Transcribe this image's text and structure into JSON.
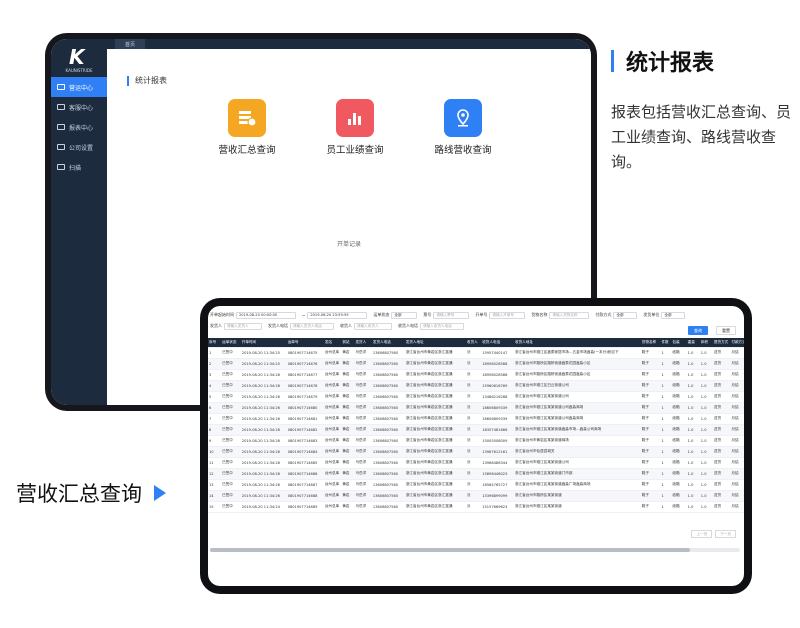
{
  "colors": {
    "accent": "#2f7ff5",
    "sidebar": "#1d2b3e",
    "card1": "#f5a623",
    "card2": "#f0595f",
    "card3": "#2f7ff5"
  },
  "app": {
    "logo_letter": "K",
    "logo_text": "KAUNISTRIDE",
    "home_tab": "首页",
    "nav": [
      {
        "label": "营运中心",
        "icon": "send-icon",
        "active": true
      },
      {
        "label": "客服中心",
        "icon": "headset-icon"
      },
      {
        "label": "报表中心",
        "icon": "chart-icon"
      },
      {
        "label": "公司设置",
        "icon": "building-icon"
      },
      {
        "label": "扫描",
        "icon": "scan-icon"
      }
    ],
    "section_title": "统计报表",
    "reports": [
      {
        "label": "营收汇总查询",
        "icon": "coin-stack-icon"
      },
      {
        "label": "员工业绩查询",
        "icon": "bar-chart-icon"
      },
      {
        "label": "路线营收查询",
        "icon": "location-pin-icon"
      }
    ],
    "empty_note": "开单记录"
  },
  "description": {
    "title": "统计报表",
    "body": "报表包括营收汇总查询、员工业绩查询、路线营收查询。"
  },
  "caption": "营收汇总查询",
  "revenue": {
    "filters1": [
      {
        "label": "开单起始时间",
        "value": "2019-08-20 00:00:00"
      },
      {
        "label": "~",
        "value": "2019-08-20 23:59:59"
      },
      {
        "label": "运单状态",
        "value": "全部"
      },
      {
        "label": "票号",
        "value": "请输入票号"
      },
      {
        "label": "开单号",
        "value": "请输入开单号"
      },
      {
        "label": "货物名称",
        "value": "请输入货物名称"
      },
      {
        "label": "付款方式",
        "value": "全部"
      },
      {
        "label": "发货单位",
        "value": "全部"
      }
    ],
    "filters2": [
      {
        "label": "发货人",
        "value": "请输入发货人"
      },
      {
        "label": "发货人电话",
        "value": "请输入发货人电话"
      },
      {
        "label": "收货人",
        "value": "请输入收货人"
      },
      {
        "label": "收货人电话",
        "value": "请输入收货人电话"
      }
    ],
    "query_btn": "查询",
    "reset_btn": "重置",
    "columns": [
      "序号",
      "运单状态",
      "开单时间",
      "运单号",
      "发站",
      "到站",
      "发货人",
      "发货人电话",
      "发货人地址",
      "收货人",
      "收货人电话",
      "收货人地址",
      "货物名称",
      "件数",
      "包装",
      "重量",
      "体积",
      "提货方式",
      "付款方式"
    ],
    "rows": [
      [
        "1",
        "已签中",
        "2019-08-20 11:34:25",
        "0801907714675",
        "台州总库",
        "黄岩",
        "马岳洋",
        "13606807560",
        "浙江省台州市黄岩区浙江富通",
        "沃",
        "15957440147",
        "浙江省台州市椒江区鑫泰家居市场…五金市场鑫淼(一本分)帐目下",
        "鞋子",
        "1",
        "纸箱",
        "1.0",
        "1.0",
        "送货",
        "月结"
      ],
      [
        "2",
        "已签中",
        "2019-08-20 11:34:25",
        "0801907714676",
        "台州总库",
        "黄岩",
        "马岳洋",
        "13606807560",
        "浙江省台州市黄岩区浙江富通",
        "沃",
        "18958028588",
        "浙江省台州市路桥区路桥街道鑫泰花园鑫淼小区",
        "鞋子",
        "1",
        "纸箱",
        "1.0",
        "1.0",
        "送货",
        "月结"
      ],
      [
        "3",
        "已签中",
        "2019-08-20 11:34:26",
        "0801907714677",
        "台州总库",
        "黄岩",
        "马岳洋",
        "13606807560",
        "浙江省台州市黄岩区浙江富通",
        "沃",
        "18958028588",
        "浙江省台州市路桥区路桥街道鑫泰花园鑫淼小区",
        "鞋子",
        "1",
        "纸箱",
        "1.0",
        "1.0",
        "送货",
        "月结"
      ],
      [
        "4",
        "已签中",
        "2019-08-20 11:34:26",
        "0801907714678",
        "台州总库",
        "黄岩",
        "马岳洋",
        "13606807560",
        "浙江省台州市黄岩区浙江富通",
        "沃",
        "15960616769",
        "浙江省台州市椒江区白云街道公司",
        "鞋子",
        "1",
        "纸箱",
        "1.0",
        "1.0",
        "送货",
        "月结"
      ],
      [
        "5",
        "已签中",
        "2019-08-20 11:34:26",
        "0801907714679",
        "台州总库",
        "黄岩",
        "马岳洋",
        "13606807560",
        "浙江省台州市黄岩区浙江富通",
        "沃",
        "13486216288",
        "浙江省台州市椒江区某某街道公司",
        "鞋子",
        "1",
        "纸箱",
        "1.0",
        "1.0",
        "送货",
        "月结"
      ],
      [
        "6",
        "已签中",
        "2019-08-20 11:34:26",
        "0801907714680",
        "台州总库",
        "黄岩",
        "马岳洋",
        "13606807560",
        "浙江省台州市黄岩区浙江富通",
        "沃",
        "18606809339",
        "浙江省台州市椒江区某某街道公司鑫淼商场",
        "鞋子",
        "1",
        "纸箱",
        "1.0",
        "1.0",
        "送货",
        "月结"
      ],
      [
        "7",
        "已签中",
        "2019-08-20 11:34:26",
        "0801907714681",
        "台州总库",
        "黄岩",
        "马岳洋",
        "13606807560",
        "浙江省台州市黄岩区浙江富通",
        "沃",
        "18606809339",
        "浙江省台州市椒江区某某街道公司鑫淼商场",
        "鞋子",
        "1",
        "纸箱",
        "1.0",
        "1.0",
        "送货",
        "月结"
      ],
      [
        "8",
        "已签中",
        "2019-08-20 11:34:26",
        "0801907714682",
        "台州总库",
        "黄岩",
        "马岳洋",
        "13606807560",
        "浙江省台州市黄岩区浙江富通",
        "沃",
        "18357481666",
        "浙江省台州市椒江区某某街道鑫淼市场…鑫淼公司商场",
        "鞋子",
        "1",
        "纸箱",
        "1.0",
        "1.0",
        "送货",
        "月结"
      ],
      [
        "9",
        "已签中",
        "2019-08-20 11:34:26",
        "0801907714683",
        "台州总库",
        "黄岩",
        "马岳洋",
        "13606807560",
        "浙江省台州市黄岩区浙江富通",
        "沃",
        "15005508009",
        "浙江省台州市黄岩区某某街道商场",
        "鞋子",
        "1",
        "纸箱",
        "1.0",
        "1.0",
        "送货",
        "月结"
      ],
      [
        "10",
        "已签中",
        "2019-08-20 11:34:26",
        "0801907714684",
        "台州总库",
        "黄岩",
        "马岳洋",
        "13606807560",
        "浙江省台州市黄岩区浙江富通",
        "沃",
        "13967612161",
        "浙江省台州市仙居县城关",
        "鞋子",
        "1",
        "纸箱",
        "1.0",
        "1.0",
        "送货",
        "月结"
      ],
      [
        "11",
        "已签中",
        "2019-08-20 11:34:26",
        "0801907714685",
        "台州总库",
        "黄岩",
        "马岳洋",
        "13606807560",
        "浙江省台州市黄岩区浙江富通",
        "沃",
        "13968486344",
        "浙江省台州市椒江区某某街道公司",
        "鞋子",
        "1",
        "纸箱",
        "1.0",
        "1.0",
        "送货",
        "月结"
      ],
      [
        "12",
        "已签中",
        "2019-08-20 11:34:26",
        "0801907714686",
        "台州总库",
        "黄岩",
        "马岳洋",
        "13606807560",
        "浙江省台州市黄岩区浙江富通",
        "沃",
        "15896448023",
        "浙江省台州市椒江区某某街道门市部",
        "鞋子",
        "1",
        "纸箱",
        "1.0",
        "1.0",
        "送货",
        "月结"
      ],
      [
        "13",
        "已签中",
        "2019-08-20 11:34:26",
        "0801907714687",
        "台州总库",
        "黄岩",
        "马岳洋",
        "13606807560",
        "浙江省台州市黄岩区浙江富通",
        "沃",
        "18584765727",
        "浙江省台州市椒江区某某街道鑫淼广场鑫淼商场",
        "鞋子",
        "1",
        "纸箱",
        "1.0",
        "1.0",
        "送货",
        "月结"
      ],
      [
        "14",
        "已签中",
        "2019-08-20 11:34:26",
        "0801907714688",
        "台州总库",
        "黄岩",
        "马岳洋",
        "13606807560",
        "浙江省台州市黄岩区浙江富通",
        "沃",
        "15396899099",
        "浙江省台州市路桥区某某街道",
        "鞋子",
        "1",
        "纸箱",
        "1.0",
        "1.0",
        "送货",
        "月结"
      ],
      [
        "15",
        "已签中",
        "2019-08-20 11:34:24",
        "0801907714689",
        "台州总库",
        "黄岩",
        "马岳洋",
        "13606807560",
        "浙江省台州市黄岩区浙江富通",
        "沃",
        "15157669623",
        "浙江省台州市椒江区某某街道",
        "鞋子",
        "1",
        "纸箱",
        "1.0",
        "1.0",
        "送货",
        "月结"
      ]
    ],
    "pager": [
      "上一页",
      "下一页"
    ]
  }
}
